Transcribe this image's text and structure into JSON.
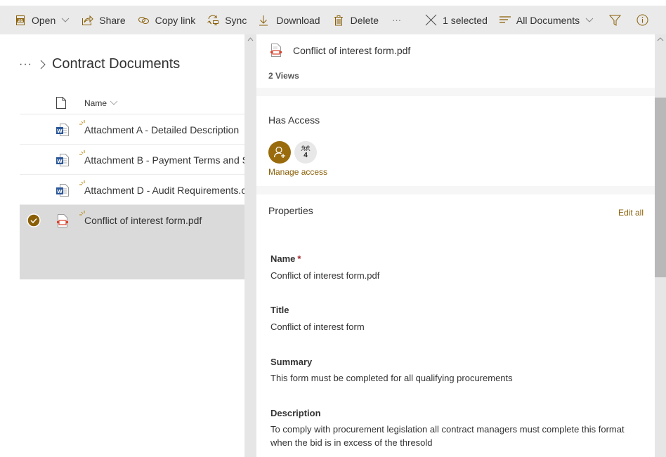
{
  "toolbar": {
    "open": "Open",
    "share": "Share",
    "copy_link": "Copy link",
    "sync": "Sync",
    "download": "Download",
    "delete": "Delete",
    "more": "···",
    "selection": "1 selected",
    "view": "All Documents"
  },
  "breadcrumb": {
    "overflow": "···",
    "current": "Contract Documents"
  },
  "list": {
    "column_name": "Name",
    "rows": [
      {
        "name": "Attachment A - Detailed Description",
        "type": "word",
        "selected": false
      },
      {
        "name": "Attachment B - Payment Terms and S",
        "type": "word",
        "selected": false
      },
      {
        "name": "Attachment D - Audit Requirements.c",
        "type": "word",
        "selected": false
      },
      {
        "name": "Conflict of interest form.pdf",
        "type": "pdf",
        "selected": true
      }
    ]
  },
  "details": {
    "file_name": "Conflict of interest form.pdf",
    "views": "2 Views",
    "has_access_title": "Has Access",
    "shared_count": "4",
    "manage_access": "Manage access",
    "properties_title": "Properties",
    "edit_all": "Edit all",
    "properties": [
      {
        "label": "Name",
        "required": true,
        "value": "Conflict of interest form.pdf"
      },
      {
        "label": "Title",
        "required": false,
        "value": "Conflict of interest form"
      },
      {
        "label": "Summary",
        "required": false,
        "value": "This form must be completed for all qualifying procurements"
      },
      {
        "label": "Description",
        "required": false,
        "value": "To comply with procurement legislation all contract managers must complete this format when the bid is in excess of the thresold"
      }
    ],
    "required_marker": "*"
  },
  "colors": {
    "accent": "#8a5f06",
    "accent_dark": "#9a6b0c",
    "toolbar_bg": "#eaeaea",
    "selected_row_bg": "#dadada",
    "word_blue": "#2b579a",
    "pdf_red": "#d9442e",
    "required_red": "#a4262c"
  }
}
